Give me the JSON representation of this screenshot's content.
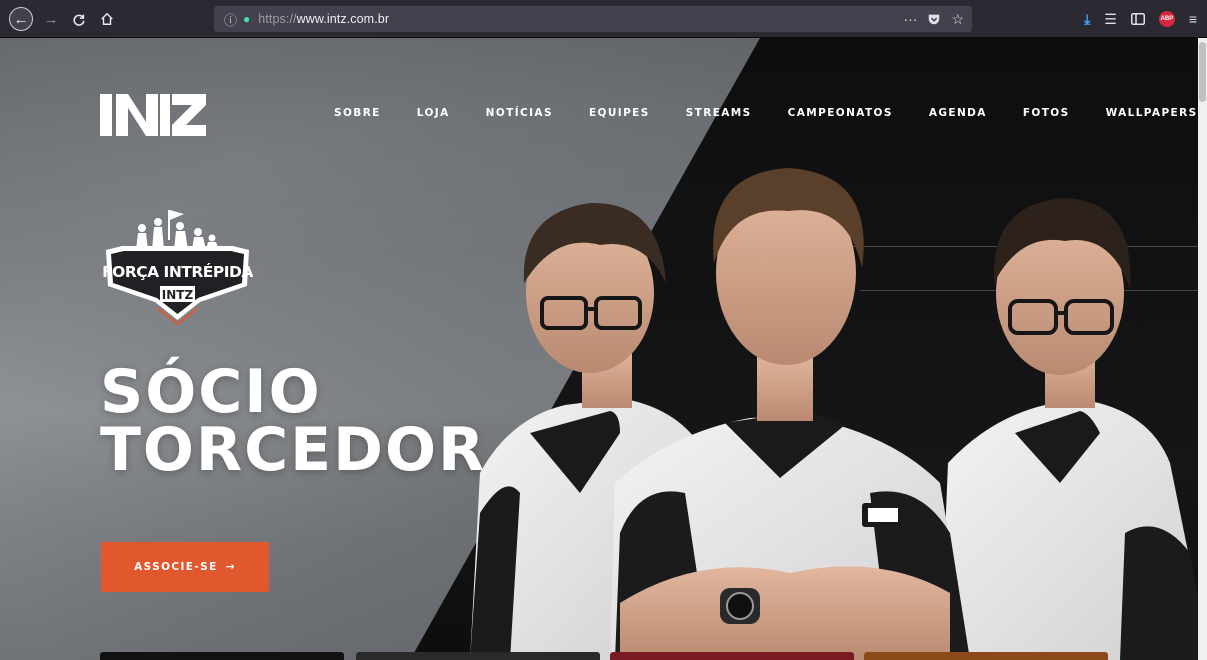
{
  "browser": {
    "url_host": "www.intz.com.br",
    "url_prefix": "https://",
    "page_actions_label": "···",
    "icons": {
      "back": "arrow-left-icon",
      "forward": "arrow-right-icon",
      "reload": "reload-icon",
      "home": "home-icon",
      "info": "info-icon",
      "lock": "lock-icon",
      "pocket": "pocket-icon",
      "bookmark": "star-icon",
      "download": "download-icon",
      "library": "library-icon",
      "sidebar": "sidebar-icon",
      "adblock": "abp-icon",
      "menu": "hamburger-menu-icon"
    },
    "abp_label": "ABP"
  },
  "site": {
    "nav": [
      {
        "label": "SOBRE"
      },
      {
        "label": "LOJA"
      },
      {
        "label": "NOTÍCIAS"
      },
      {
        "label": "EQUIPES"
      },
      {
        "label": "STREAMS"
      },
      {
        "label": "CAMPEONATOS"
      },
      {
        "label": "AGENDA"
      },
      {
        "label": "FOTOS"
      },
      {
        "label": "WALLPAPERS"
      }
    ],
    "hero": {
      "title_line1": "SÓCIO",
      "title_line2": "TORCEDOR",
      "cta_label": "ASSOCIE-SE",
      "cta_arrow": "→",
      "badge_text": "FORÇA INTRÉPIDA",
      "badge_logo": "INTZ"
    },
    "colors": {
      "accent": "#e1582f",
      "dark": "#111111",
      "text": "#ffffff"
    }
  }
}
